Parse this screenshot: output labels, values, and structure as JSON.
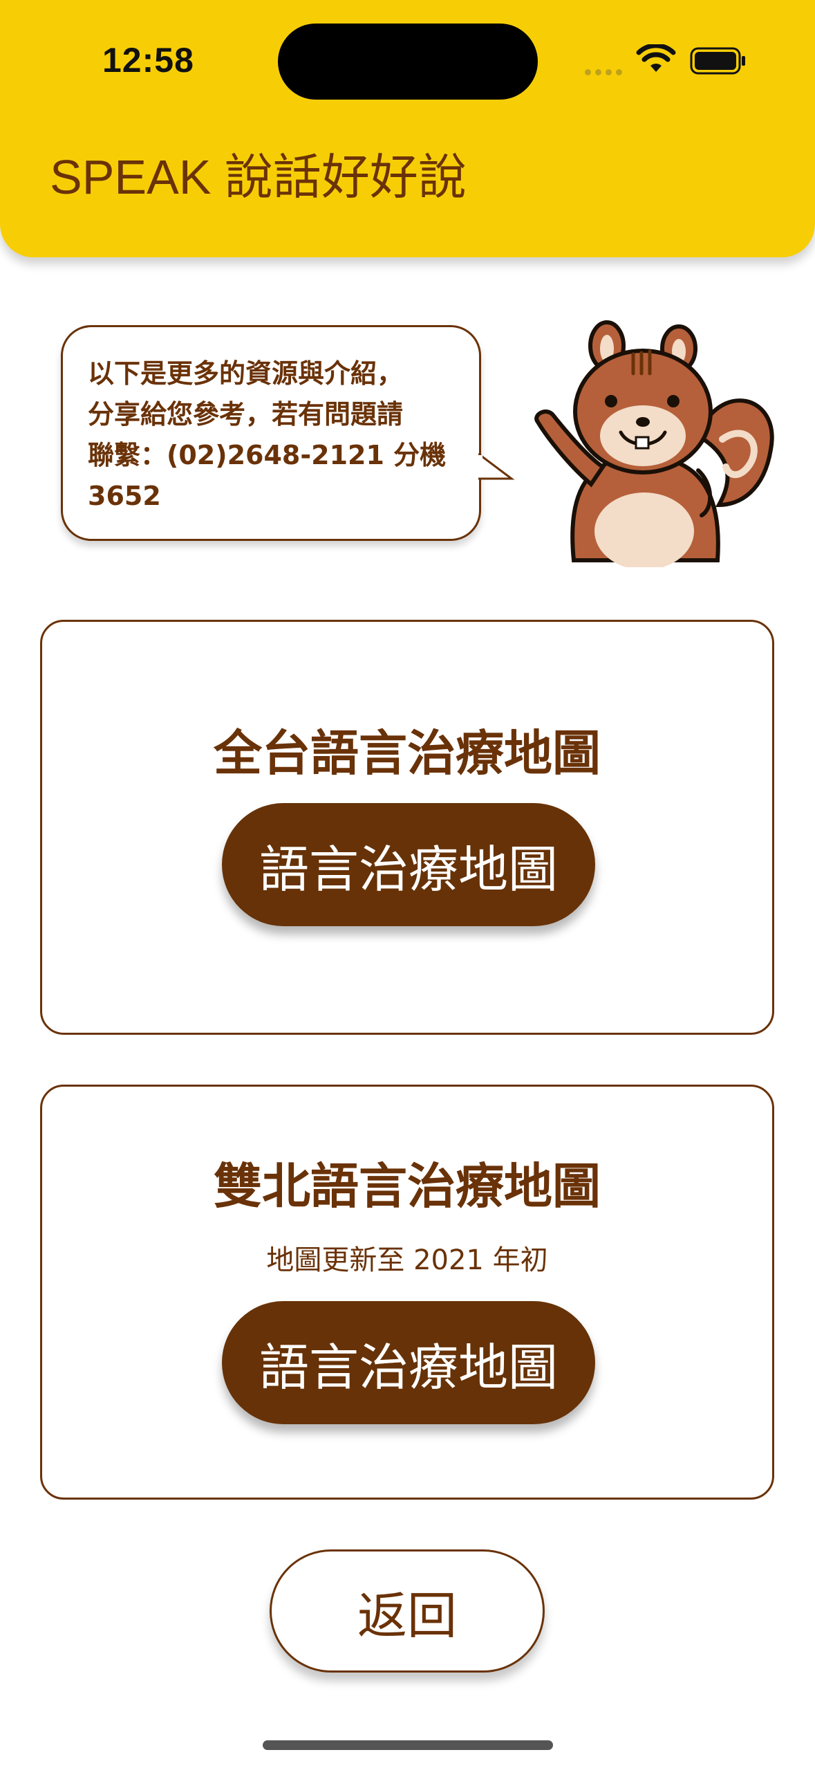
{
  "status_bar": {
    "time": "12:58",
    "icons": [
      "signal-dots-icon",
      "wifi-icon",
      "battery-icon"
    ]
  },
  "header": {
    "title": "SPEAK 說話好好說"
  },
  "bubble": {
    "text": "以下是更多的資源與介紹，\n分享給您參考，若有問題請\n聯繫：(02)2648-2121 分機\n3652"
  },
  "cards": [
    {
      "title": "全台語言治療地圖",
      "button_label": "語言治療地圖"
    },
    {
      "title": "雙北語言治療地圖",
      "subtitle": "地圖更新至 2021 年初",
      "button_label": "語言治療地圖"
    }
  ],
  "back_label": "返回",
  "colors": {
    "header_bg": "#f7ce06",
    "brown": "#6a3208",
    "button_bg": "#673207",
    "white": "#ffffff"
  }
}
